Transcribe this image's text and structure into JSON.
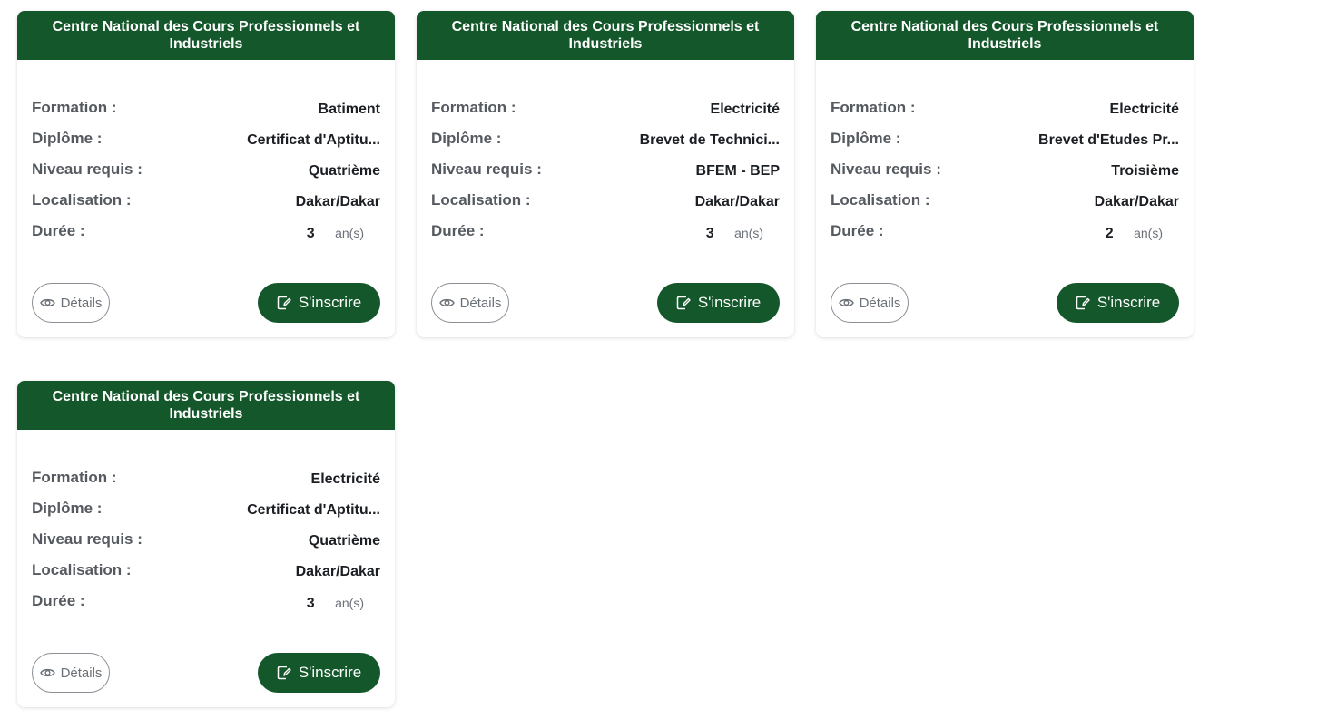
{
  "labels": {
    "formation": "Formation :",
    "diplome": "Diplôme :",
    "niveau": "Niveau requis :",
    "localisation": "Localisation :",
    "duree": "Durée :",
    "duree_unit": "an(s)",
    "details_button": "Détails",
    "inscrire_button": "S'inscrire"
  },
  "colors": {
    "brand_green": "#13572a"
  },
  "icons": {
    "details": "eye-icon",
    "inscrire": "edit-icon"
  },
  "cards": [
    {
      "title": "Centre National des Cours Professionnels et Industriels",
      "formation": "Batiment",
      "diplome": "Certificat d'Aptitu...",
      "niveau": "Quatrième",
      "localisation": "Dakar/Dakar",
      "duree": "3"
    },
    {
      "title": "Centre National des Cours Professionnels et Industriels",
      "formation": "Electricité",
      "diplome": "Brevet de Technici...",
      "niveau": "BFEM - BEP",
      "localisation": "Dakar/Dakar",
      "duree": "3"
    },
    {
      "title": "Centre National des Cours Professionnels et Industriels",
      "formation": "Electricité",
      "diplome": "Brevet d'Etudes Pr...",
      "niveau": "Troisième",
      "localisation": "Dakar/Dakar",
      "duree": "2"
    },
    {
      "title": "Centre National des Cours Professionnels et Industriels",
      "formation": "Electricité",
      "diplome": "Certificat d'Aptitu...",
      "niveau": "Quatrième",
      "localisation": "Dakar/Dakar",
      "duree": "3"
    }
  ]
}
